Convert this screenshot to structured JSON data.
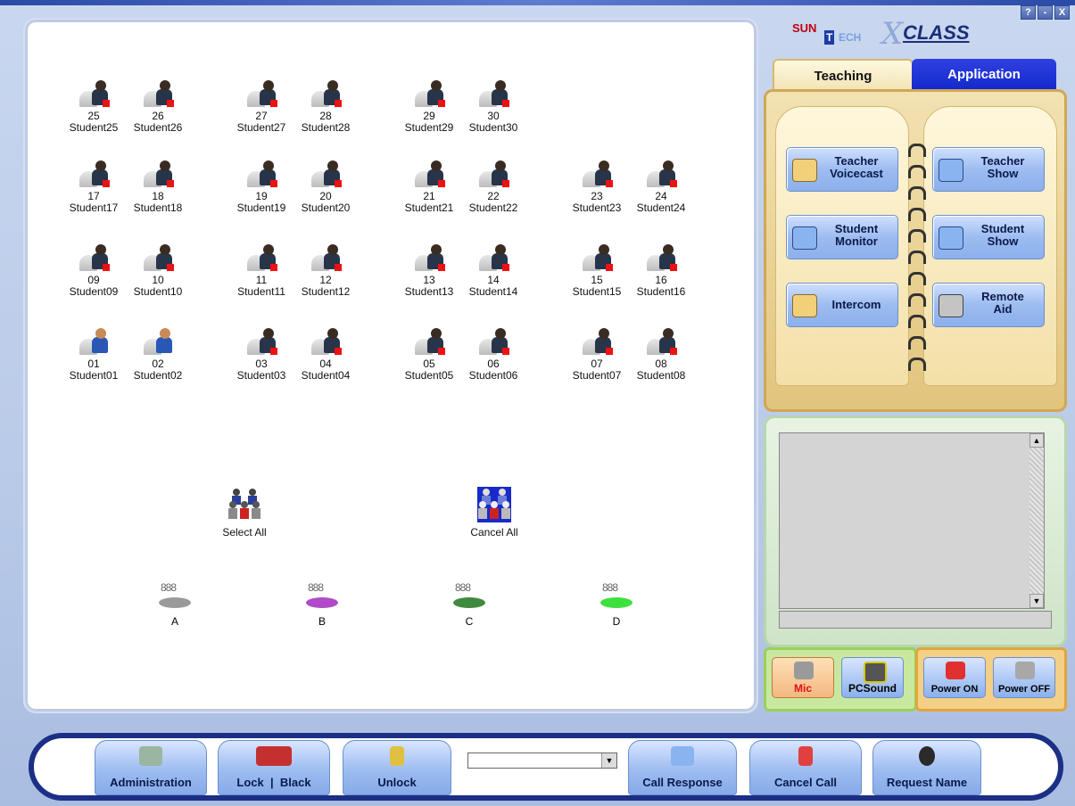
{
  "students": [
    {
      "num": "25",
      "name": "Student25",
      "online": false
    },
    {
      "num": "26",
      "name": "Student26",
      "online": false
    },
    {
      "num": "27",
      "name": "Student27",
      "online": false
    },
    {
      "num": "28",
      "name": "Student28",
      "online": false
    },
    {
      "num": "29",
      "name": "Student29",
      "online": false
    },
    {
      "num": "30",
      "name": "Student30",
      "online": false
    },
    {
      "num": "17",
      "name": "Student17",
      "online": false
    },
    {
      "num": "18",
      "name": "Student18",
      "online": false
    },
    {
      "num": "19",
      "name": "Student19",
      "online": false
    },
    {
      "num": "20",
      "name": "Student20",
      "online": false
    },
    {
      "num": "21",
      "name": "Student21",
      "online": false
    },
    {
      "num": "22",
      "name": "Student22",
      "online": false
    },
    {
      "num": "23",
      "name": "Student23",
      "online": false
    },
    {
      "num": "24",
      "name": "Student24",
      "online": false
    },
    {
      "num": "09",
      "name": "Student09",
      "online": false
    },
    {
      "num": "10",
      "name": "Student10",
      "online": false
    },
    {
      "num": "11",
      "name": "Student11",
      "online": false
    },
    {
      "num": "12",
      "name": "Student12",
      "online": false
    },
    {
      "num": "13",
      "name": "Student13",
      "online": false
    },
    {
      "num": "14",
      "name": "Student14",
      "online": false
    },
    {
      "num": "15",
      "name": "Student15",
      "online": false
    },
    {
      "num": "16",
      "name": "Student16",
      "online": false
    },
    {
      "num": "01",
      "name": "Student01",
      "online": true
    },
    {
      "num": "02",
      "name": "Student02",
      "online": true
    },
    {
      "num": "03",
      "name": "Student03",
      "online": false
    },
    {
      "num": "04",
      "name": "Student04",
      "online": false
    },
    {
      "num": "05",
      "name": "Student05",
      "online": false
    },
    {
      "num": "06",
      "name": "Student06",
      "online": false
    },
    {
      "num": "07",
      "name": "Student07",
      "online": false
    },
    {
      "num": "08",
      "name": "Student08",
      "online": false
    }
  ],
  "select_all": "Select All",
  "cancel_all": "Cancel All",
  "groups": [
    {
      "label": "A",
      "color": "#9a9a9a"
    },
    {
      "label": "B",
      "color": "#b04ac8"
    },
    {
      "label": "C",
      "color": "#3f8a3f"
    },
    {
      "label": "D",
      "color": "#3ee03e"
    }
  ],
  "logo": {
    "sun": "SUN",
    "tech": "T",
    "ech": "ECH",
    "class": "CLASS"
  },
  "window_buttons": [
    "?",
    "-",
    "X"
  ],
  "tabs": {
    "teaching": "Teaching",
    "application": "Application"
  },
  "teaching_buttons": {
    "teacher_voicecast": [
      "Teacher",
      "Voicecast"
    ],
    "teacher_show": [
      "Teacher",
      "Show"
    ],
    "student_monitor": [
      "Student",
      "Monitor"
    ],
    "student_show": [
      "Student",
      "Show"
    ],
    "intercom": "Intercom",
    "remote_aid": [
      "Remote",
      "Aid"
    ]
  },
  "sound": {
    "mic": "Mic",
    "pcsound": "PCSound"
  },
  "power": {
    "on": "Power ON",
    "off": "Power OFF"
  },
  "toolbar": {
    "administration": "Administration",
    "lock": "Lock",
    "black": "Black",
    "unlock": "Unlock",
    "dropdown_value": "",
    "call_response": "Call Response",
    "cancel_call": "Cancel Call",
    "request_name": "Request Name"
  },
  "colors": {
    "accent_blue": "#1228cc",
    "toolbar_border": "#1b2f86",
    "mic_label": "#e01010"
  }
}
